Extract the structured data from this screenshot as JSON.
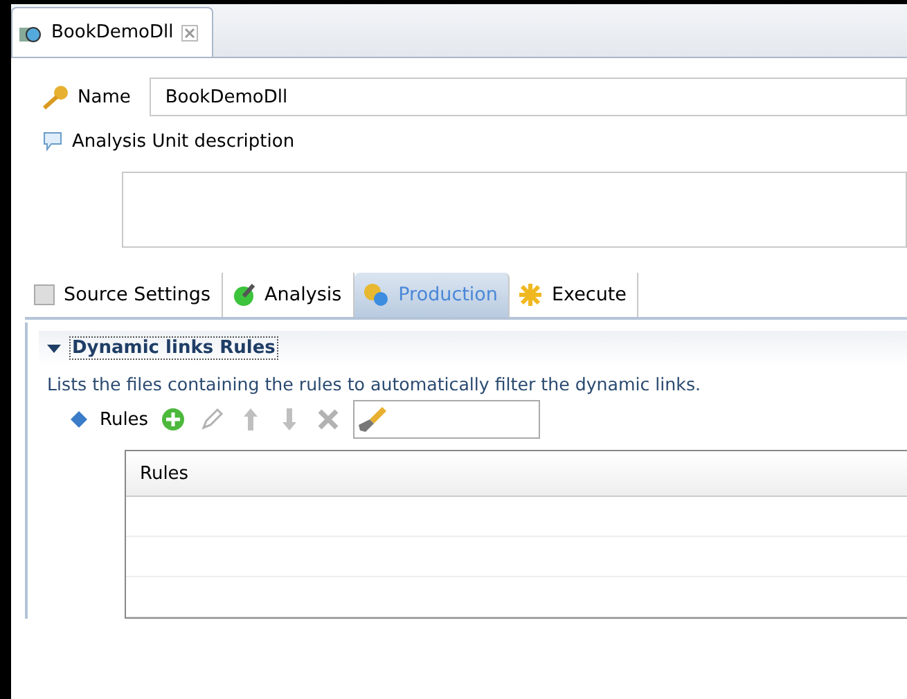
{
  "editor_tab": {
    "title": "BookDemoDll"
  },
  "name": {
    "label": "Name",
    "value": "BookDemoDll"
  },
  "description": {
    "label": "Analysis Unit description"
  },
  "tabs": [
    {
      "label": "Source Settings",
      "kind": "source",
      "selected": false
    },
    {
      "label": "Analysis",
      "kind": "analysis",
      "selected": false
    },
    {
      "label": "Production",
      "kind": "production",
      "selected": true
    },
    {
      "label": "Execute",
      "kind": "execute",
      "selected": false
    }
  ],
  "section": {
    "title": "Dynamic links Rules",
    "expanded": true,
    "description": "Lists the files containing the rules to automatically filter the dynamic links.",
    "rules_label": "Rules",
    "toolbar": [
      {
        "kind": "add",
        "disabled": false
      },
      {
        "kind": "edit",
        "disabled": true
      },
      {
        "kind": "up",
        "disabled": true
      },
      {
        "kind": "down",
        "disabled": true
      },
      {
        "kind": "delete",
        "disabled": true
      }
    ],
    "table": {
      "columns": [
        "Rules"
      ]
    }
  }
}
